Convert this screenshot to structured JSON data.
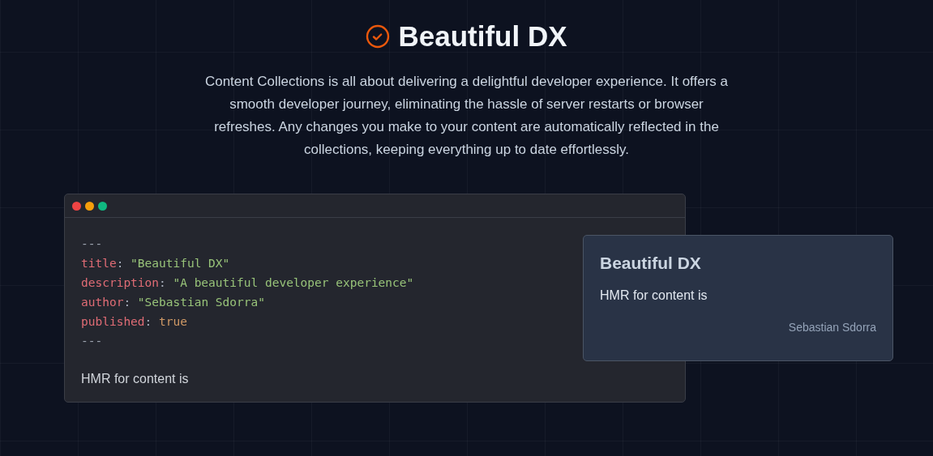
{
  "heading": {
    "title": "Beautiful DX",
    "description": "Content Collections is all about delivering a delightful developer experience. It offers a smooth developer journey, eliminating the hassle of server restarts or browser refreshes. Any changes you make to your content are automatically reflected in the collections, keeping everything up to date effortlessly."
  },
  "editor": {
    "window_dots": [
      {
        "color": "#ef4444"
      },
      {
        "color": "#f59e0b"
      },
      {
        "color": "#10b981"
      }
    ],
    "lines": [
      {
        "tokens": [
          {
            "kind": "delimiter",
            "text": "---"
          }
        ]
      },
      {
        "tokens": [
          {
            "kind": "key",
            "text": "title"
          },
          {
            "kind": "punctuation",
            "text": ":"
          },
          {
            "kind": "string",
            "text": "\"Beautiful DX\""
          }
        ]
      },
      {
        "tokens": [
          {
            "kind": "key",
            "text": "description"
          },
          {
            "kind": "punctuation",
            "text": ":"
          },
          {
            "kind": "string",
            "text": "\"A beautiful developer experience\""
          }
        ]
      },
      {
        "tokens": [
          {
            "kind": "key",
            "text": "author"
          },
          {
            "kind": "punctuation",
            "text": ":"
          },
          {
            "kind": "string",
            "text": "\"Sebastian Sdorra\""
          }
        ]
      },
      {
        "tokens": [
          {
            "kind": "key",
            "text": "published"
          },
          {
            "kind": "punctuation",
            "text": ":"
          },
          {
            "kind": "boolean",
            "text": "true"
          }
        ]
      },
      {
        "tokens": [
          {
            "kind": "delimiter",
            "text": "---"
          }
        ]
      }
    ],
    "body": "HMR for content is"
  },
  "preview": {
    "title": "Beautiful DX",
    "body": "HMR for content is",
    "author": "Sebastian Sdorra"
  }
}
